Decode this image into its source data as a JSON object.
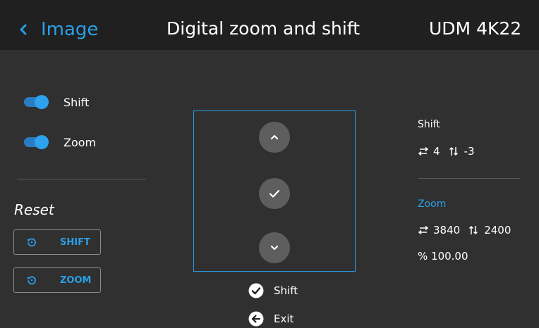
{
  "header": {
    "back_label": "Image",
    "title": "Digital zoom and shift",
    "device": "UDM 4K22"
  },
  "toggles": [
    {
      "label": "Shift",
      "on": true
    },
    {
      "label": "Zoom",
      "on": true
    }
  ],
  "reset": {
    "title": "Reset",
    "buttons": [
      {
        "label": "SHIFT",
        "icon": "reset-icon"
      },
      {
        "label": "ZOOM",
        "icon": "reset-icon"
      }
    ]
  },
  "control": {
    "up_icon": "chevron-up-icon",
    "confirm_icon": "check-icon",
    "down_icon": "chevron-down-icon"
  },
  "hints": [
    {
      "icon": "check-circle-icon",
      "label": "Shift"
    },
    {
      "icon": "arrow-left-circle-icon",
      "label": "Exit"
    }
  ],
  "info": {
    "shift_label": "Shift",
    "shift_h": "4",
    "shift_v": "-3",
    "zoom_label": "Zoom",
    "zoom_h": "3840",
    "zoom_v": "2400",
    "zoom_percent": "% 100.00"
  },
  "colors": {
    "accent": "#2a9fe6",
    "background": "#303030",
    "header": "#202020",
    "button_fill": "#5e5e5e"
  }
}
